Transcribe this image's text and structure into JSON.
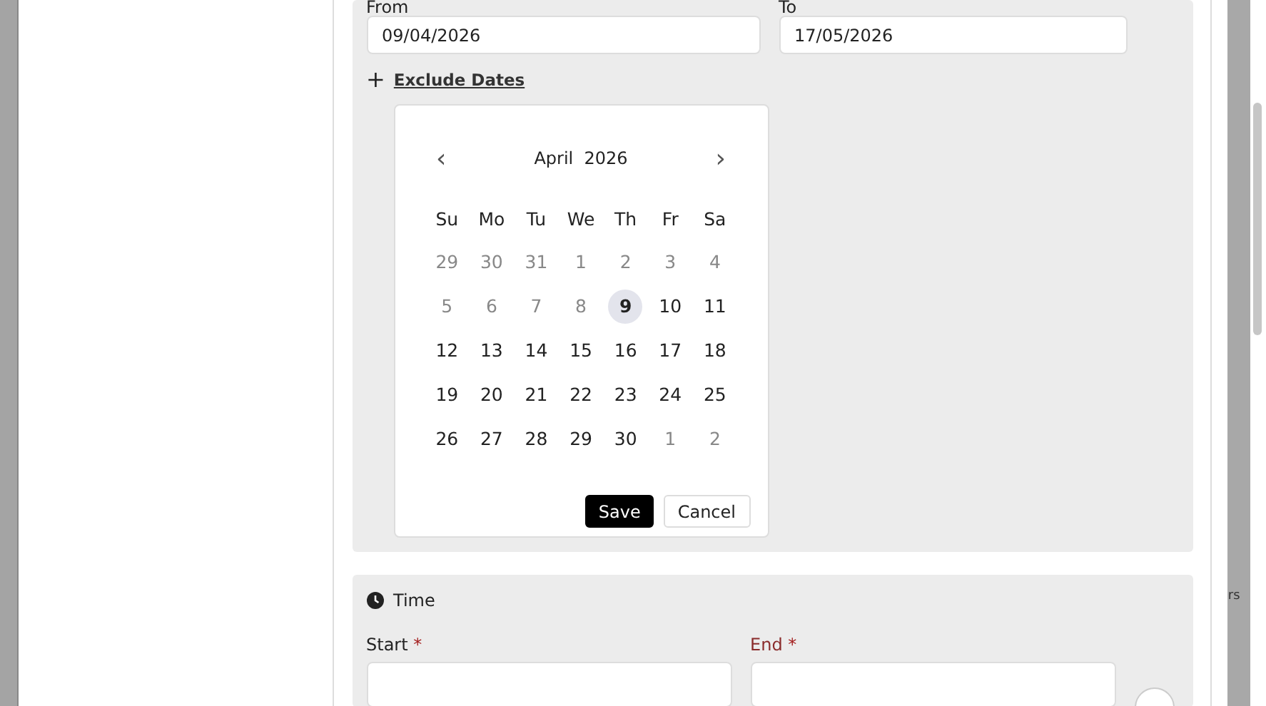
{
  "date_range": {
    "from": {
      "label": "From",
      "value": "09/04/2026"
    },
    "to": {
      "label": "To",
      "value": "17/05/2026"
    }
  },
  "exclude_link": {
    "icon": "+",
    "label": "Exclude Dates"
  },
  "calendar": {
    "prev": "‹",
    "next": "›",
    "month": "April",
    "year": "2026",
    "weekdays": [
      "Su",
      "Mo",
      "Tu",
      "We",
      "Th",
      "Fr",
      "Sa"
    ],
    "days": [
      {
        "label": "29",
        "disabled": true,
        "highlighted": false
      },
      {
        "label": "30",
        "disabled": true,
        "highlighted": false
      },
      {
        "label": "31",
        "disabled": true,
        "highlighted": false
      },
      {
        "label": "1",
        "disabled": true,
        "highlighted": false
      },
      {
        "label": "2",
        "disabled": true,
        "highlighted": false
      },
      {
        "label": "3",
        "disabled": true,
        "highlighted": false
      },
      {
        "label": "4",
        "disabled": true,
        "highlighted": false
      },
      {
        "label": "5",
        "disabled": true,
        "highlighted": false
      },
      {
        "label": "6",
        "disabled": true,
        "highlighted": false
      },
      {
        "label": "7",
        "disabled": true,
        "highlighted": false
      },
      {
        "label": "8",
        "disabled": true,
        "highlighted": false
      },
      {
        "label": "9",
        "disabled": false,
        "highlighted": true
      },
      {
        "label": "10",
        "disabled": false,
        "highlighted": false
      },
      {
        "label": "11",
        "disabled": false,
        "highlighted": false
      },
      {
        "label": "12",
        "disabled": false,
        "highlighted": false
      },
      {
        "label": "13",
        "disabled": false,
        "highlighted": false
      },
      {
        "label": "14",
        "disabled": false,
        "highlighted": false
      },
      {
        "label": "15",
        "disabled": false,
        "highlighted": false
      },
      {
        "label": "16",
        "disabled": false,
        "highlighted": false
      },
      {
        "label": "17",
        "disabled": false,
        "highlighted": false
      },
      {
        "label": "18",
        "disabled": false,
        "highlighted": false
      },
      {
        "label": "19",
        "disabled": false,
        "highlighted": false
      },
      {
        "label": "20",
        "disabled": false,
        "highlighted": false
      },
      {
        "label": "21",
        "disabled": false,
        "highlighted": false
      },
      {
        "label": "22",
        "disabled": false,
        "highlighted": false
      },
      {
        "label": "23",
        "disabled": false,
        "highlighted": false
      },
      {
        "label": "24",
        "disabled": false,
        "highlighted": false
      },
      {
        "label": "25",
        "disabled": false,
        "highlighted": false
      },
      {
        "label": "26",
        "disabled": false,
        "highlighted": false
      },
      {
        "label": "27",
        "disabled": false,
        "highlighted": false
      },
      {
        "label": "28",
        "disabled": false,
        "highlighted": false
      },
      {
        "label": "29",
        "disabled": false,
        "highlighted": false
      },
      {
        "label": "30",
        "disabled": false,
        "highlighted": false
      },
      {
        "label": "1",
        "disabled": true,
        "highlighted": false
      },
      {
        "label": "2",
        "disabled": true,
        "highlighted": false
      }
    ],
    "buttons": [
      {
        "label": "Save",
        "kind": "primary"
      },
      {
        "label": "Cancel",
        "kind": "secondary"
      }
    ]
  },
  "time": {
    "title": "Time",
    "fields": [
      {
        "label": "Start",
        "required": "*",
        "error": false
      },
      {
        "label": "End",
        "required": "*",
        "error": true
      }
    ],
    "add_button": true
  },
  "background_text": "rs"
}
